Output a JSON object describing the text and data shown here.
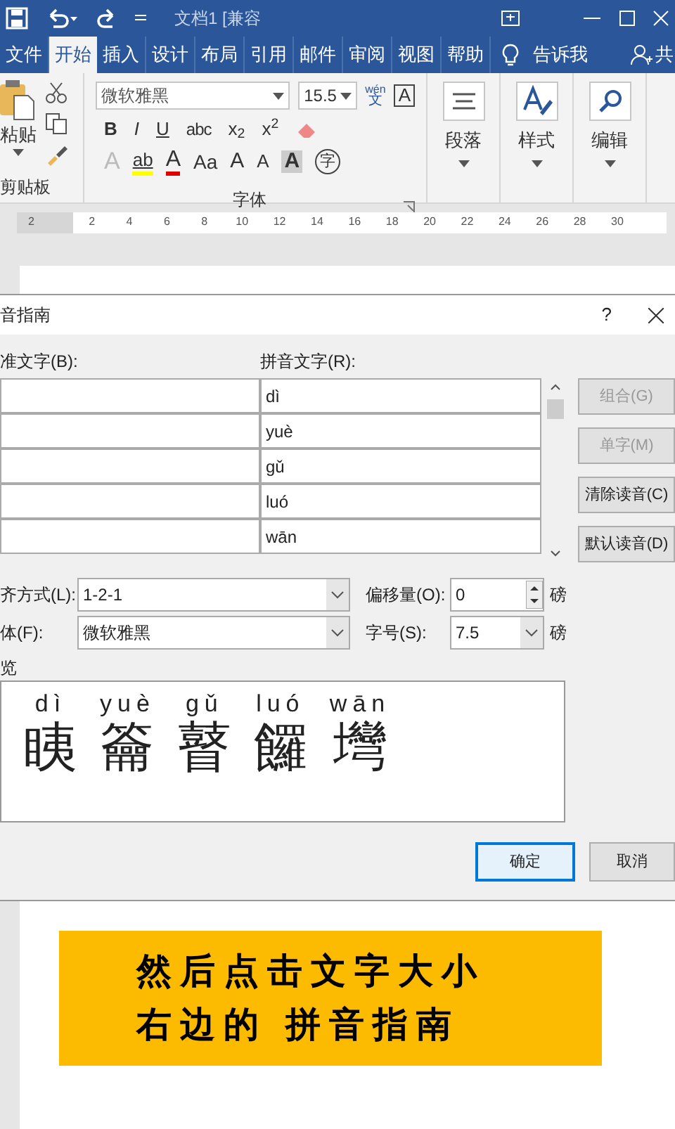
{
  "title_bar": {
    "title": "文档1 [兼容"
  },
  "ribbon_tabs": [
    {
      "label": "文件",
      "selected": false
    },
    {
      "label": "开始",
      "selected": true
    },
    {
      "label": "插入",
      "selected": false
    },
    {
      "label": "设计",
      "selected": false
    },
    {
      "label": "布局",
      "selected": false
    },
    {
      "label": "引用",
      "selected": false
    },
    {
      "label": "邮件",
      "selected": false
    },
    {
      "label": "审阅",
      "selected": false
    },
    {
      "label": "视图",
      "selected": false
    },
    {
      "label": "帮助",
      "selected": false
    }
  ],
  "tell_me": "告诉我",
  "share": "共",
  "clipboard": {
    "paste": "粘贴",
    "group_label": "剪贴板"
  },
  "font_group": {
    "font_name": "微软雅黑",
    "font_size": "15.5",
    "pinyin_top": "wén",
    "pinyin_char": "文",
    "border_char": "A",
    "group_label": "字体",
    "format_buttons": [
      {
        "label": "B",
        "kind": "bold"
      },
      {
        "label": "I",
        "kind": "italic"
      },
      {
        "label": "U",
        "kind": "underline"
      },
      {
        "label": "abc",
        "kind": "strike"
      },
      {
        "label": "x$_{2}$",
        "kind": "script"
      },
      {
        "label": "x$^{2}$",
        "kind": "script"
      }
    ],
    "effect_buttons": [
      {
        "label": "A",
        "kind": "outline"
      },
      {
        "label": "ab",
        "kind": "highlight",
        "color": "#ffff00"
      },
      {
        "label": "A",
        "kind": "fontcolor",
        "color": "#e00000"
      },
      {
        "label": "Aa",
        "kind": "case"
      },
      {
        "label": "A",
        "kind": "grow"
      },
      {
        "label": "A",
        "kind": "shrink"
      },
      {
        "label": "A",
        "kind": "shade"
      },
      {
        "label": "字",
        "kind": "enclose"
      }
    ]
  },
  "big_groups": [
    {
      "label": "段落",
      "kind": "paragraph"
    },
    {
      "label": "样式",
      "kind": "styles"
    },
    {
      "label": "编辑",
      "kind": "editing"
    }
  ],
  "ruler": {
    "ticks": [
      "2",
      "2",
      "4",
      "6",
      "8",
      "10",
      "12",
      "14",
      "16",
      "18",
      "20",
      "22",
      "24",
      "26",
      "28",
      "30"
    ]
  },
  "dialog": {
    "title": "音指南",
    "help": "?",
    "base_label": "准文字(B):",
    "ruby_label": "拼音文字(R):",
    "rows": [
      {
        "ruby": "dì"
      },
      {
        "ruby": "yuè"
      },
      {
        "ruby": "gǔ"
      },
      {
        "ruby": "luó"
      },
      {
        "ruby": "wān"
      }
    ],
    "side_buttons": [
      {
        "label": "组合(G)",
        "disabled": true
      },
      {
        "label": "单字(M)",
        "disabled": true
      },
      {
        "label": "清除读音(C)",
        "disabled": false
      },
      {
        "label": "默认读音(D)",
        "disabled": false
      }
    ],
    "alignment": {
      "label": "齐方式(L):",
      "value": "1-2-1"
    },
    "offset": {
      "label": "偏移量(O):",
      "value": "0",
      "unit": "磅"
    },
    "font": {
      "label": "体(F):",
      "value": "微软雅黑"
    },
    "size": {
      "label": "字号(S):",
      "value": "7.5",
      "unit": "磅"
    },
    "preview_label": "览",
    "preview": [
      {
        "ruby": "dì",
        "char": "眱"
      },
      {
        "ruby": "yuè",
        "char": "籥"
      },
      {
        "ruby": "gǔ",
        "char": "瞽"
      },
      {
        "ruby": "luó",
        "char": "饠"
      },
      {
        "ruby": "wān",
        "char": "壪"
      }
    ],
    "ok": "确定",
    "cancel": "取消"
  },
  "caption": [
    "然后点击文字大小",
    "右边的 拼音指南"
  ]
}
